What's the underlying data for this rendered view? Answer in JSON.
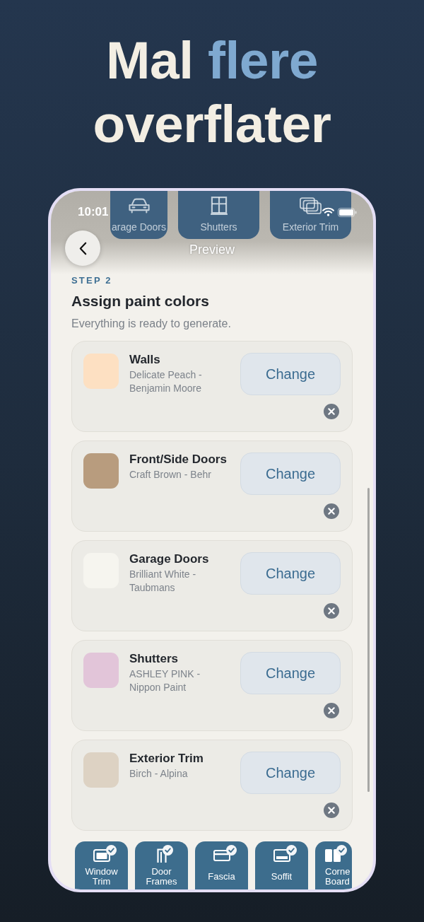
{
  "headline": [
    {
      "text": "Mal",
      "highlight": false
    },
    {
      "text": "flere",
      "highlight": true
    },
    {
      "text": "overflater",
      "highlight": false
    }
  ],
  "status_bar": {
    "time": "10:01"
  },
  "background_tiles": [
    {
      "label": "arage Doors"
    },
    {
      "label": "Shutters"
    },
    {
      "label": "Exterior Trim"
    }
  ],
  "nav": {
    "title": "Preview"
  },
  "step": {
    "label": "STEP 2",
    "title": "Assign paint colors",
    "subtitle": "Everything is ready to generate."
  },
  "assignments": [
    {
      "surface": "Walls",
      "paint": "Delicate Peach - Benjamin Moore",
      "color": "#fde0c2",
      "button": "Change"
    },
    {
      "surface": "Front/Side Doors",
      "paint": "Craft Brown - Behr",
      "color": "#b89c7e",
      "button": "Change"
    },
    {
      "surface": "Garage Doors",
      "paint": "Brilliant White - Taubmans",
      "color": "#f6f5ef",
      "button": "Change"
    },
    {
      "surface": "Shutters",
      "paint": "ASHLEY PINK - Nippon Paint",
      "color": "#e2c5d9",
      "button": "Change"
    },
    {
      "surface": "Exterior Trim",
      "paint": "Birch - Alpina",
      "color": "#ddd2c3",
      "button": "Change"
    }
  ],
  "surfaces": [
    {
      "label": "Window Trim",
      "checked": true
    },
    {
      "label": "Door Frames",
      "checked": true
    },
    {
      "label": "Fascia",
      "checked": true
    },
    {
      "label": "Soffit",
      "checked": true
    },
    {
      "label": "Corne Board",
      "checked": true
    }
  ]
}
